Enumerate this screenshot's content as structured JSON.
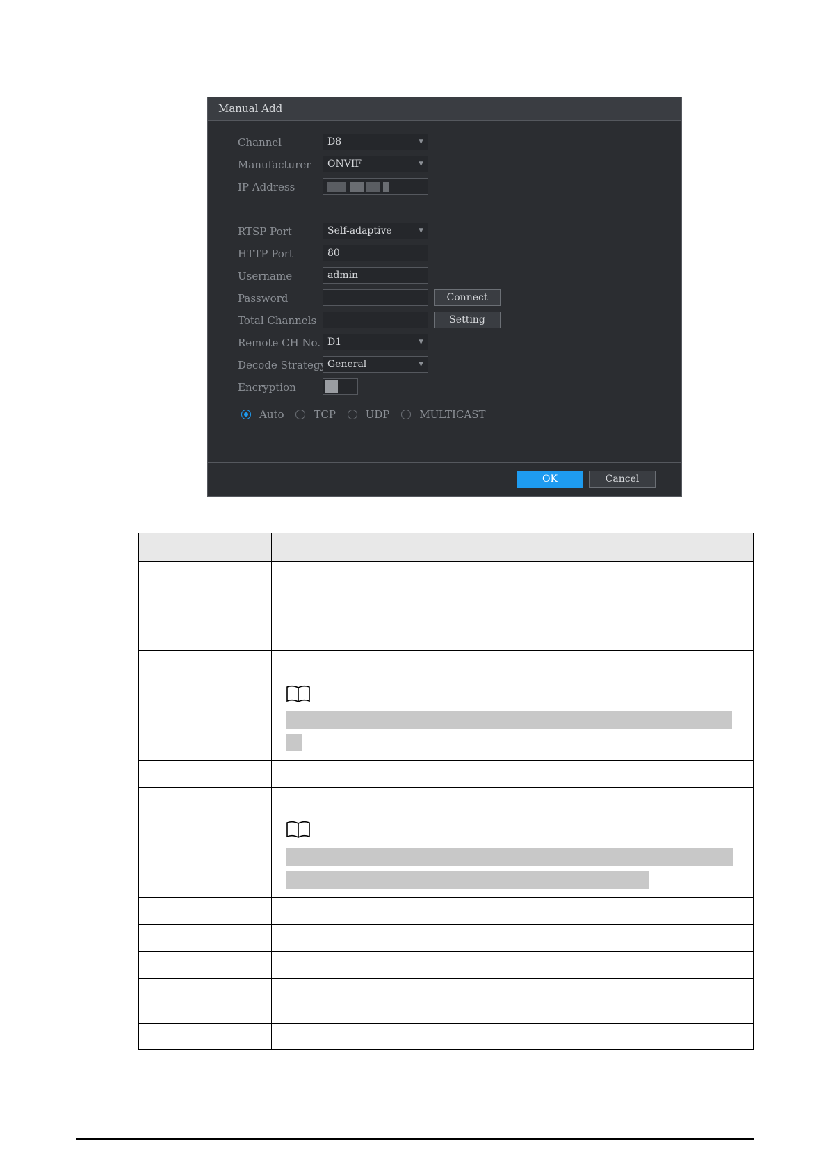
{
  "dialog": {
    "title": "Manual Add",
    "fields": {
      "channel": {
        "label": "Channel",
        "value": "D8"
      },
      "manufacturer": {
        "label": "Manufacturer",
        "value": "ONVIF"
      },
      "ip_address": {
        "label": "IP Address",
        "value": ""
      },
      "rtsp_port": {
        "label": "RTSP Port",
        "value": "Self-adaptive"
      },
      "http_port": {
        "label": "HTTP Port",
        "value": "80"
      },
      "username": {
        "label": "Username",
        "value": "admin"
      },
      "password": {
        "label": "Password",
        "value": ""
      },
      "total_channels": {
        "label": "Total Channels",
        "value": ""
      },
      "remote_ch_no": {
        "label": "Remote CH No.",
        "value": "D1"
      },
      "decode_strategy": {
        "label": "Decode Strategy",
        "value": "General"
      },
      "encryption": {
        "label": "Encryption",
        "enabled": false
      }
    },
    "buttons": {
      "connect": "Connect",
      "setting": "Setting",
      "ok": "OK",
      "cancel": "Cancel"
    },
    "protocols": [
      "Auto",
      "TCP",
      "UDP",
      "MULTICAST"
    ],
    "selected_protocol": "Auto",
    "colors": {
      "accent": "#1e9bf0",
      "panel": "#2b2d31"
    }
  }
}
